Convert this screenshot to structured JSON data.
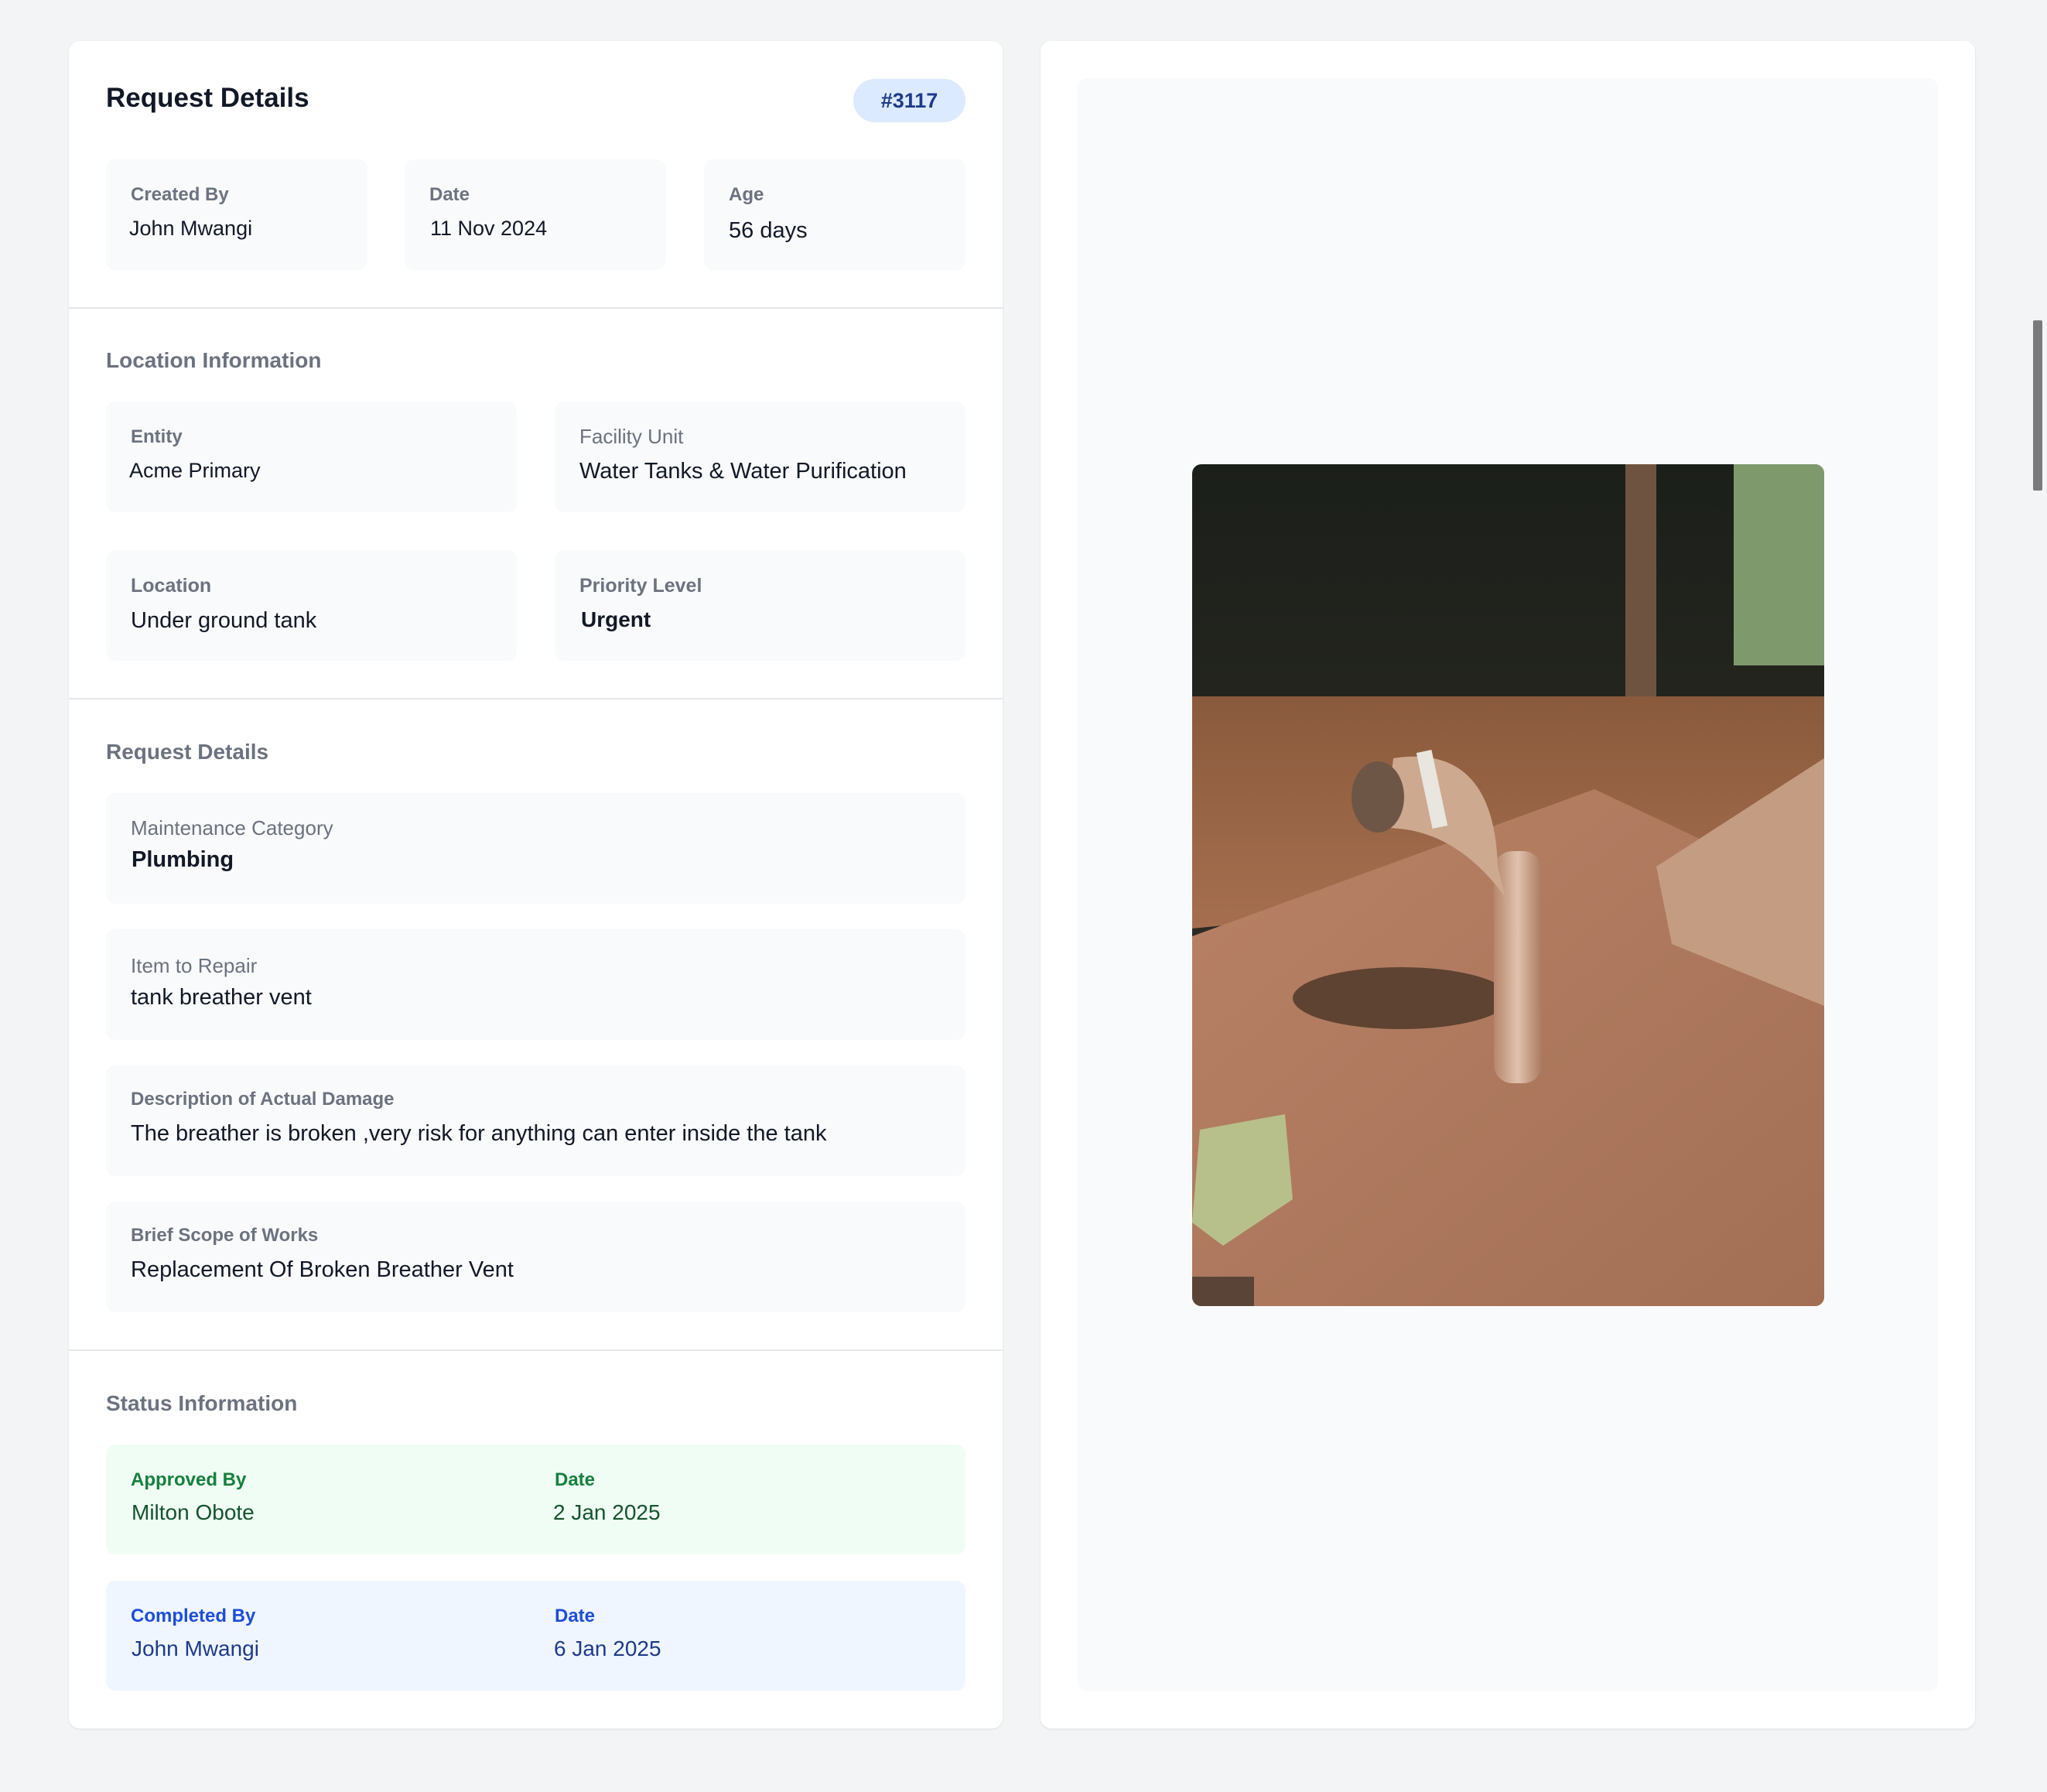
{
  "header": {
    "title": "Request Details",
    "request_id": "#3117"
  },
  "summary": {
    "created_by": {
      "label": "Created By",
      "value": "John Mwangi"
    },
    "date": {
      "label": "Date",
      "value": "11 Nov 2024"
    },
    "age": {
      "label": "Age",
      "value": "56 days"
    }
  },
  "location": {
    "section_title": "Location Information",
    "entity": {
      "label": "Entity",
      "value": "Acme Primary"
    },
    "facility_unit": {
      "label": "Facility Unit",
      "value": "Water Tanks & Water Purification"
    },
    "location": {
      "label": "Location",
      "value": "Under ground tank"
    },
    "priority": {
      "label": "Priority Level",
      "value": "Urgent"
    }
  },
  "request": {
    "section_title": "Request Details",
    "category": {
      "label": "Maintenance Category",
      "value": "Plumbing"
    },
    "item": {
      "label": "Item to Repair",
      "value": "tank breather vent"
    },
    "damage": {
      "label": "Description of Actual Damage",
      "value": "The breather is broken ,very risk for anything can enter inside the tank"
    },
    "scope": {
      "label": "Brief Scope of Works",
      "value": "Replacement Of Broken Breather Vent"
    }
  },
  "status": {
    "section_title": "Status Information",
    "approved": {
      "label": "Approved By",
      "value": "Milton Obote",
      "date_label": "Date",
      "date_value": "2 Jan 2025"
    },
    "completed": {
      "label": "Completed By",
      "value": "John Mwangi",
      "date_label": "Date",
      "date_value": "6 Jan 2025"
    }
  },
  "colors": {
    "badge_bg": "#dbeafe",
    "approved_bg": "#f0fdf4",
    "approved_text": "#15803d",
    "completed_bg": "#eff6ff",
    "completed_text": "#1d4ed8"
  },
  "media": {
    "icon": "damage-photo"
  }
}
